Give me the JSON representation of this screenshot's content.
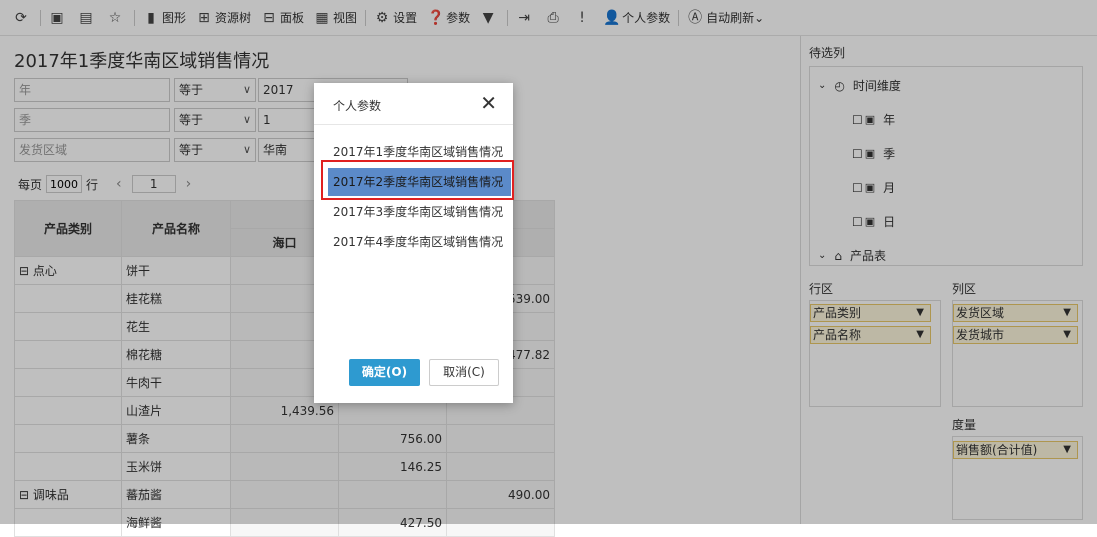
{
  "toolbar": {
    "graph": "图形",
    "resource_tree": "资源树",
    "panel": "面板",
    "view": "视图",
    "settings": "设置",
    "params": "参数",
    "personal_params": "个人参数",
    "auto_refresh": "自动刷新"
  },
  "report": {
    "title": "2017年1季度华南区域销售情况",
    "filters": [
      {
        "field": "年",
        "op": "等于",
        "value": "2017"
      },
      {
        "field": "季",
        "op": "等于",
        "value": "1"
      },
      {
        "field": "发货区域",
        "op": "等于",
        "value": "华南"
      }
    ],
    "pager": {
      "per_page_label": "每页",
      "per_page": "1000",
      "rows_label": "行",
      "prev": "‹",
      "page": "1",
      "next": "›"
    },
    "table": {
      "headers": [
        "产品类别",
        "产品名称",
        "海口"
      ],
      "rows": [
        {
          "cat": "⊟ 点心",
          "name": "饼干",
          "c1": "",
          "c2": "",
          "c3": ""
        },
        {
          "cat": "",
          "name": "桂花糕",
          "c1": "",
          "c2": "",
          "c3": "539.00"
        },
        {
          "cat": "",
          "name": "花生",
          "c1": "",
          "c2": "",
          "c3": ""
        },
        {
          "cat": "",
          "name": "棉花糖",
          "c1": "",
          "c2": "",
          "c3": "477.82"
        },
        {
          "cat": "",
          "name": "牛肉干",
          "c1": "",
          "c2": "",
          "c3": ""
        },
        {
          "cat": "",
          "name": "山渣片",
          "c1": "1,439.56",
          "c2": "",
          "c3": ""
        },
        {
          "cat": "",
          "name": "薯条",
          "c1": "",
          "c2": "756.00",
          "c3": ""
        },
        {
          "cat": "",
          "name": "玉米饼",
          "c1": "",
          "c2": "146.25",
          "c3": ""
        },
        {
          "cat": "⊟ 调味品",
          "name": "蕃茄酱",
          "c1": "",
          "c2": "",
          "c3": "490.00"
        },
        {
          "cat": "",
          "name": "海鲜酱",
          "c1": "",
          "c2": "427.50",
          "c3": ""
        }
      ]
    }
  },
  "right_panel": {
    "pending_label": "待选列",
    "time_dim": "时间维度",
    "year": "年",
    "quarter": "季",
    "month": "月",
    "day": "日",
    "product_table": "产品表",
    "row_area": "行区",
    "col_area": "列区",
    "measure_area": "度量",
    "row_chips": [
      "产品类别",
      "产品名称"
    ],
    "col_chips": [
      "发货区域",
      "发货城市"
    ],
    "measure_chips": [
      "销售额(合计值)"
    ]
  },
  "dialog": {
    "title": "个人参数",
    "items": [
      "2017年1季度华南区域销售情况",
      "2017年2季度华南区域销售情况",
      "2017年3季度华南区域销售情况",
      "2017年4季度华南区域销售情况"
    ],
    "ok": "确定(O)",
    "cancel": "取消(C)"
  }
}
